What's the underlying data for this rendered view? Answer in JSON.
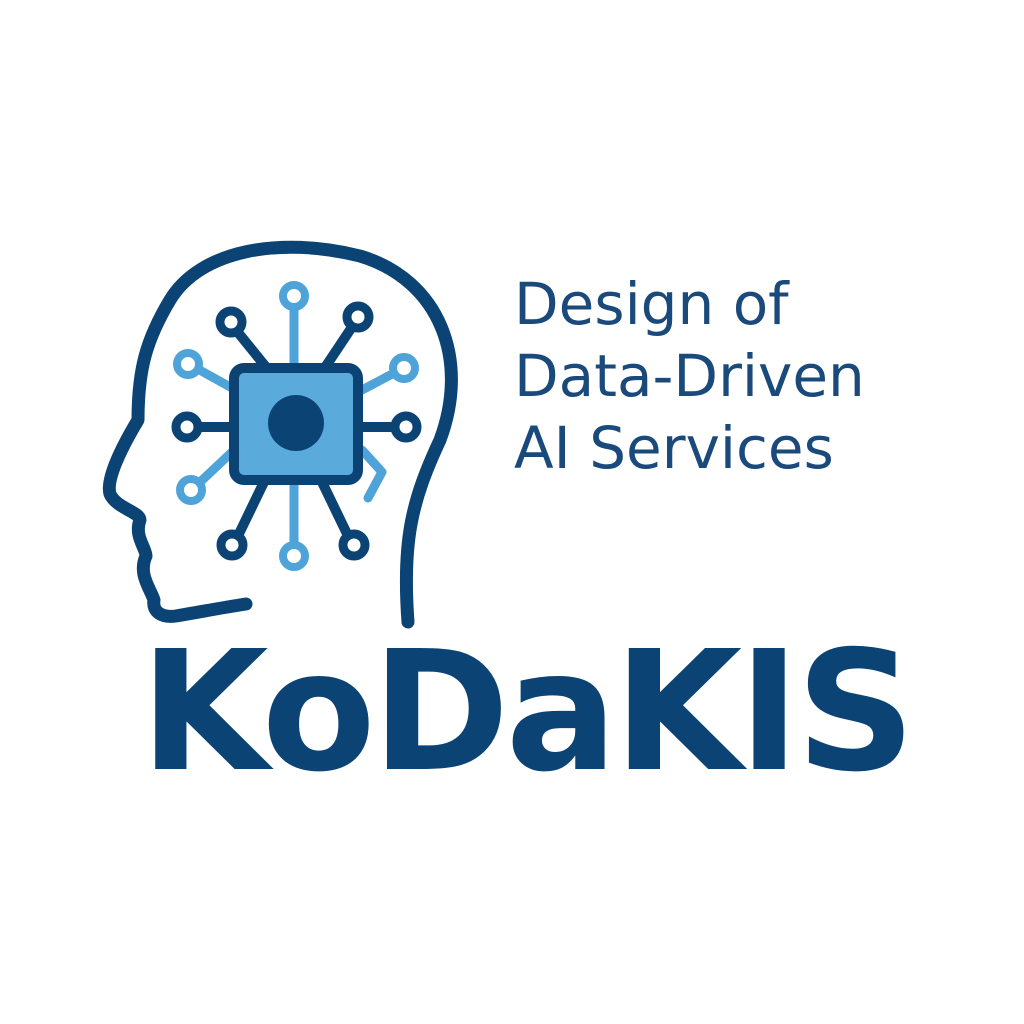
{
  "logo": {
    "tagline_lines": [
      "Design of",
      "Data-Driven",
      "AI Services"
    ],
    "wordmark": "KoDaKIS",
    "icon": "head-with-circuit-chip-icon",
    "colors": {
      "dark_blue": "#0b4474",
      "text_blue": "#1a4a7c",
      "light_blue": "#4ea3d8",
      "chip_fill": "#5aaadb",
      "background": "#ffffff"
    }
  }
}
